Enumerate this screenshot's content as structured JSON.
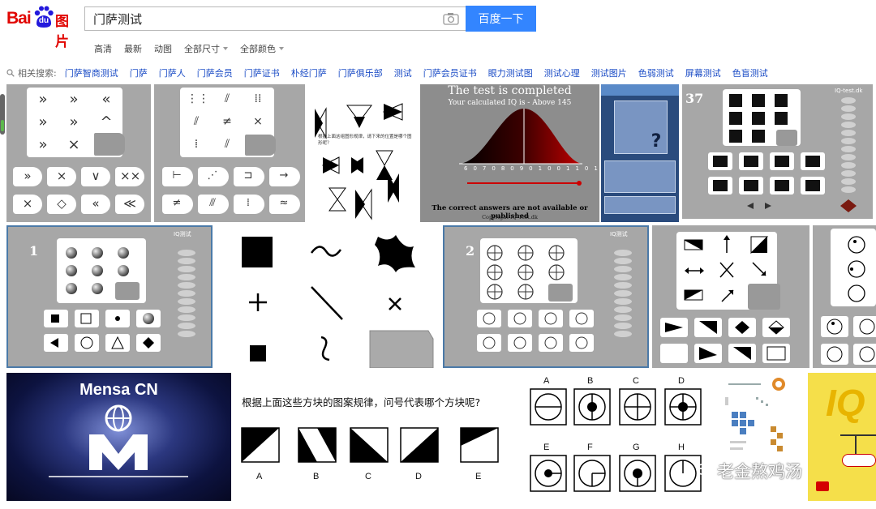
{
  "header": {
    "logo": {
      "bai": "Bai",
      "du": "du",
      "pic": "图片"
    },
    "search": {
      "value": "门萨测试",
      "button_label": "百度一下"
    }
  },
  "filters": [
    {
      "label": "高清",
      "dropdown": false
    },
    {
      "label": "最新",
      "dropdown": false
    },
    {
      "label": "动图",
      "dropdown": false
    },
    {
      "label": "全部尺寸",
      "dropdown": true
    },
    {
      "label": "全部颜色",
      "dropdown": true
    }
  ],
  "related": {
    "label": "相关搜索:",
    "items": [
      "门萨智商测试",
      "门萨",
      "门萨人",
      "门萨会员",
      "门萨证书",
      "朴经门萨",
      "门萨俱乐部",
      "测试",
      "门萨会员证书",
      "眼力测试图",
      "测试心理",
      "测试图片",
      "色弱测试",
      "屏幕测试",
      "色盲测试"
    ]
  },
  "images": {
    "bell": {
      "title": "The test is completed",
      "subtitle": "Your calculated IQ is - Above 145",
      "footer": "The correct answers are not available or published",
      "copyright": "Copyright IQ-Test.dk"
    },
    "tile6_number": "37",
    "tile6_site": "IQ-test.dk",
    "tile7_number": "1",
    "tile9_number": "2",
    "iq_site": "IQ测试",
    "mensa_title": "Mensa CN",
    "question_text": "根据上面这些方块的图案规律，问号代表哪个方块呢?",
    "question_options": [
      "A",
      "B",
      "C",
      "D",
      "E"
    ],
    "circle_options": [
      "A",
      "B",
      "C",
      "D",
      "E",
      "F",
      "G",
      "H"
    ],
    "iq_cover": "IQ",
    "tile3_text": "根据上面这组图形规律，请下来的位置是哪个图形呢？"
  },
  "watermark": "老金熬鸡汤",
  "colors": {
    "brand_red": "#e10602",
    "brand_blue": "#2319dc",
    "button_blue": "#3385ff",
    "link_blue": "#1b4cc6"
  }
}
